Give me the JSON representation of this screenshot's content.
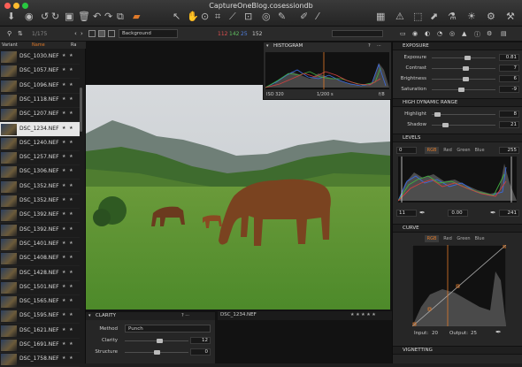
{
  "window": {
    "title": "CaptureOneBlog.cosessiondb"
  },
  "toolbar": {
    "icons": [
      "import-icon",
      "camera-icon",
      "undo-icon",
      "redo-icon",
      "delete-icon",
      "trash-icon",
      "rotate-left-icon",
      "rotate-right-icon",
      "variant-icon",
      "cursor-icon",
      "pan-icon",
      "loupe-icon",
      "crop-icon",
      "straighten-icon",
      "keystone-icon",
      "brush-icon",
      "picker-icon",
      "grid-icon",
      "warning-icon",
      "tool-icon",
      "share-icon",
      "eyedropper-icon",
      "settings-icon"
    ]
  },
  "subbar": {
    "counter": "1/175",
    "collection": "Background",
    "rgb_r": "112",
    "rgb_g": "142",
    "rgb_b": "25",
    "rgb_a": "152"
  },
  "browser": {
    "col_variant": "Variant",
    "col_name": "Name",
    "col_rating": "Ra",
    "files": [
      {
        "name": "DSC_1030.NEF",
        "stars": "★ ★"
      },
      {
        "name": "DSC_1057.NEF",
        "stars": "★ ★"
      },
      {
        "name": "DSC_1096.NEF",
        "stars": "★ ★"
      },
      {
        "name": "DSC_1118.NEF",
        "stars": "★ ★"
      },
      {
        "name": "DSC_1207.NEF",
        "stars": "★ ★"
      },
      {
        "name": "DSC_1234.NEF",
        "stars": "★ ★"
      },
      {
        "name": "DSC_1240.NEF",
        "stars": "★ ★"
      },
      {
        "name": "DSC_1257.NEF",
        "stars": "★ ★"
      },
      {
        "name": "DSC_1306.NEF",
        "stars": "★ ★"
      },
      {
        "name": "DSC_1352.NEF",
        "stars": "★ ★"
      },
      {
        "name": "DSC_1352.NEF",
        "stars": "★ ★"
      },
      {
        "name": "DSC_1392.NEF",
        "stars": "★ ★"
      },
      {
        "name": "DSC_1392.NEF",
        "stars": "★ ★"
      },
      {
        "name": "DSC_1401.NEF",
        "stars": "★ ★"
      },
      {
        "name": "DSC_1408.NEF",
        "stars": "★ ★"
      },
      {
        "name": "DSC_1428.NEF",
        "stars": "★ ★"
      },
      {
        "name": "DSC_1501.NEF",
        "stars": "★ ★"
      },
      {
        "name": "DSC_1565.NEF",
        "stars": "★ ★"
      },
      {
        "name": "DSC_1595.NEF",
        "stars": "★ ★"
      },
      {
        "name": "DSC_1621.NEF",
        "stars": "★ ★"
      },
      {
        "name": "DSC_1691.NEF",
        "stars": "★ ★"
      },
      {
        "name": "DSC_1758.NEF",
        "stars": "★ ★"
      }
    ],
    "selected_index": 5
  },
  "histogram": {
    "title": "HISTOGRAM",
    "iso": "ISO 320",
    "shutter": "1/200 s",
    "aperture": "f/8"
  },
  "viewer": {
    "caption": "DSC_1234.NEF",
    "caption_stars": "★ ★ ★ ★ ★"
  },
  "clarity": {
    "title": "CLARITY",
    "method_label": "Method",
    "method_value": "Punch",
    "clarity_label": "Clarity",
    "clarity_value": "12",
    "structure_label": "Structure",
    "structure_value": "0"
  },
  "exposure": {
    "title": "EXPOSURE",
    "rows": [
      {
        "label": "Exposure",
        "value": "0.81",
        "level": 0.56
      },
      {
        "label": "Contrast",
        "value": "7",
        "level": 0.53
      },
      {
        "label": "Brightness",
        "value": "6",
        "level": 0.53
      },
      {
        "label": "Saturation",
        "value": "-9",
        "level": 0.46
      }
    ]
  },
  "hdr": {
    "title": "HIGH DYNAMIC RANGE",
    "rows": [
      {
        "label": "Highlight",
        "value": "8",
        "level": 0.08
      },
      {
        "label": "Shadow",
        "value": "21",
        "level": 0.21
      }
    ]
  },
  "levels": {
    "title": "LEVELS",
    "left_value": "0",
    "right_value": "255",
    "low": "11",
    "mid": "0.00",
    "high": "241",
    "tabs": [
      "RGB",
      "Red",
      "Green",
      "Blue"
    ]
  },
  "curve": {
    "title": "CURVE",
    "tabs": [
      "RGB",
      "Red",
      "Green",
      "Blue"
    ],
    "input_label": "Input:",
    "input_value": "20",
    "output_label": "Output:",
    "output_value": "25"
  },
  "vignetting": {
    "title": "VIGNETTING"
  },
  "colors": {
    "accent": "#e07a2a",
    "panel": "#262626",
    "bg": "#1e1e1e"
  }
}
